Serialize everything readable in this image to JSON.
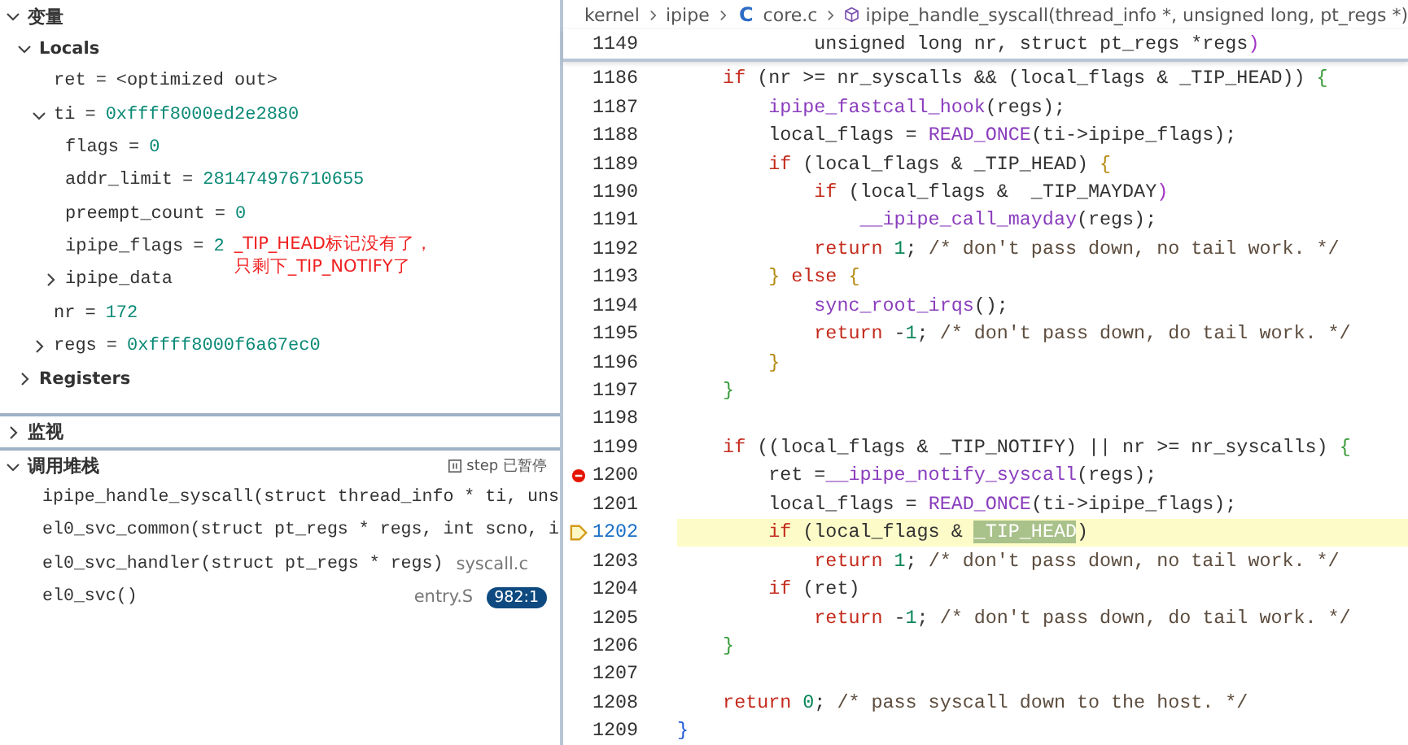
{
  "variables": {
    "title": "变量",
    "expanded": true,
    "scopes": [
      {
        "name": "Locals",
        "expanded": true,
        "children": [
          {
            "name": "ret",
            "sep": "=",
            "value": "<optimized out>",
            "kind": "text"
          },
          {
            "name": "ti",
            "sep": "=",
            "value": "0xffff8000ed2e2880",
            "kind": "value",
            "expanded": true,
            "children": [
              {
                "name": "flags",
                "sep": "=",
                "value": "0",
                "kind": "value"
              },
              {
                "name": "addr_limit",
                "sep": "=",
                "value": "281474976710655",
                "kind": "value"
              },
              {
                "name": "preempt_count",
                "sep": "=",
                "value": "0",
                "kind": "value"
              },
              {
                "name": "ipipe_flags",
                "sep": "=",
                "value": "2",
                "kind": "value",
                "note": [
                  "_TIP_HEAD标记没有了，",
                  "只剩下_TIP_NOTIFY了"
                ]
              },
              {
                "name": "ipipe_data",
                "expanded": false
              }
            ]
          },
          {
            "name": "nr",
            "sep": "=",
            "value": "172",
            "kind": "value"
          },
          {
            "name": "regs",
            "sep": "=",
            "value": "0xffff8000f6a67ec0",
            "kind": "value",
            "expanded": false
          }
        ]
      },
      {
        "name": "Registers",
        "expanded": false
      }
    ]
  },
  "watch": {
    "title": "监视",
    "expanded": false
  },
  "call_stack": {
    "title": "调用堆栈",
    "expanded": true,
    "status": "step 已暂停",
    "frames": [
      {
        "name": "ipipe_handle_syscall(struct thread_info * ti, uns"
      },
      {
        "name": "el0_svc_common(struct pt_regs * regs, int scno, i"
      },
      {
        "name": "el0_svc_handler(struct pt_regs * regs)",
        "file": "syscall.c"
      },
      {
        "name": "el0_svc()",
        "file": "entry.S",
        "badge": "982:1"
      }
    ]
  },
  "breadcrumb": [
    {
      "label": "kernel",
      "kind": "folder"
    },
    {
      "label": "ipipe",
      "kind": "folder"
    },
    {
      "label": "core.c",
      "kind": "file",
      "icon": "C"
    },
    {
      "label": "ipipe_handle_syscall(thread_info *, unsigned long, pt_regs *)",
      "kind": "function"
    }
  ],
  "sticky_line": {
    "num": "1149",
    "tokens": [
      {
        "text": "            unsigned long nr, struct pt_regs *regs",
        "kind": "plain"
      },
      {
        "text": ")",
        "kind": "paren"
      }
    ]
  },
  "lines": [
    {
      "num": "1186",
      "breakpoint": false,
      "current": false,
      "tokens": [
        {
          "text": "    if",
          "kind": "keyword"
        },
        {
          "text": " (nr >= nr_syscalls && (local_flags & _TIP_HEAD)) ",
          "kind": "plain"
        },
        {
          "text": "{",
          "kind": "brace1"
        }
      ]
    },
    {
      "num": "1187",
      "breakpoint": false,
      "current": false,
      "tokens": [
        {
          "text": "        ipipe_fastcall_hook",
          "kind": "function"
        },
        {
          "text": "(regs);",
          "kind": "plain"
        }
      ]
    },
    {
      "num": "1188",
      "breakpoint": false,
      "current": false,
      "tokens": [
        {
          "text": "        local_flags = ",
          "kind": "plain"
        },
        {
          "text": "READ_ONCE",
          "kind": "function"
        },
        {
          "text": "(ti->ipipe_flags);",
          "kind": "plain"
        }
      ]
    },
    {
      "num": "1189",
      "breakpoint": false,
      "current": false,
      "tokens": [
        {
          "text": "        if",
          "kind": "keyword"
        },
        {
          "text": " (local_flags & _TIP_HEAD) ",
          "kind": "plain"
        },
        {
          "text": "{",
          "kind": "brace2"
        }
      ]
    },
    {
      "num": "1190",
      "breakpoint": false,
      "current": false,
      "tokens": [
        {
          "text": "            if",
          "kind": "keyword"
        },
        {
          "text": " (local_flags &  _TIP_MAYDAY",
          "kind": "plain"
        },
        {
          "text": ")",
          "kind": "paren"
        }
      ]
    },
    {
      "num": "1191",
      "breakpoint": false,
      "current": false,
      "tokens": [
        {
          "text": "                __ipipe_call_mayday",
          "kind": "function"
        },
        {
          "text": "(regs);",
          "kind": "plain"
        }
      ]
    },
    {
      "num": "1192",
      "breakpoint": false,
      "current": false,
      "tokens": [
        {
          "text": "            return",
          "kind": "keyword"
        },
        {
          "text": " 1",
          "kind": "number"
        },
        {
          "text": "; ",
          "kind": "plain"
        },
        {
          "text": "/* don't pass down, no tail work. */",
          "kind": "comment"
        }
      ]
    },
    {
      "num": "1193",
      "breakpoint": false,
      "current": false,
      "tokens": [
        {
          "text": "        }",
          "kind": "brace2"
        },
        {
          "text": " else",
          "kind": "keyword"
        },
        {
          "text": " {",
          "kind": "brace2"
        }
      ]
    },
    {
      "num": "1194",
      "breakpoint": false,
      "current": false,
      "tokens": [
        {
          "text": "            sync_root_irqs",
          "kind": "function"
        },
        {
          "text": "();",
          "kind": "plain"
        }
      ]
    },
    {
      "num": "1195",
      "breakpoint": false,
      "current": false,
      "tokens": [
        {
          "text": "            return",
          "kind": "keyword"
        },
        {
          "text": " -",
          "kind": "plain"
        },
        {
          "text": "1",
          "kind": "number"
        },
        {
          "text": "; ",
          "kind": "plain"
        },
        {
          "text": "/* don't pass down, do tail work. */",
          "kind": "comment"
        }
      ]
    },
    {
      "num": "1196",
      "breakpoint": false,
      "current": false,
      "tokens": [
        {
          "text": "        }",
          "kind": "brace2"
        }
      ]
    },
    {
      "num": "1197",
      "breakpoint": false,
      "current": false,
      "tokens": [
        {
          "text": "    }",
          "kind": "brace1"
        }
      ]
    },
    {
      "num": "1198",
      "breakpoint": false,
      "current": false
    },
    {
      "num": "1199",
      "breakpoint": false,
      "current": false,
      "tokens": [
        {
          "text": "    if",
          "kind": "keyword"
        },
        {
          "text": " ((local_flags & _TIP_NOTIFY) || nr >= nr_syscalls) ",
          "kind": "plain"
        },
        {
          "text": "{",
          "kind": "brace1"
        }
      ]
    },
    {
      "num": "1200",
      "breakpoint": true,
      "current": false,
      "tokens": [
        {
          "text": "        ret =",
          "kind": "plain"
        },
        {
          "text": "__ipipe_notify_syscall",
          "kind": "function"
        },
        {
          "text": "(regs);",
          "kind": "plain"
        }
      ]
    },
    {
      "num": "1201",
      "breakpoint": false,
      "current": false,
      "tokens": [
        {
          "text": "        local_flags = ",
          "kind": "plain"
        },
        {
          "text": "READ_ONCE",
          "kind": "function"
        },
        {
          "text": "(ti->ipipe_flags);",
          "kind": "plain"
        }
      ]
    },
    {
      "num": "1202",
      "breakpoint": false,
      "current": true,
      "tokens": [
        {
          "text": "        if",
          "kind": "keyword"
        },
        {
          "text": " (local_flags & ",
          "kind": "plain"
        },
        {
          "text": "_TIP_HEAD",
          "kind": "highlight"
        },
        {
          "text": ")",
          "kind": "plain"
        }
      ]
    },
    {
      "num": "1203",
      "breakpoint": false,
      "current": false,
      "tokens": [
        {
          "text": "            return",
          "kind": "keyword"
        },
        {
          "text": " 1",
          "kind": "number"
        },
        {
          "text": "; ",
          "kind": "plain"
        },
        {
          "text": "/* don't pass down, no tail work. */",
          "kind": "comment"
        }
      ]
    },
    {
      "num": "1204",
      "breakpoint": false,
      "current": false,
      "tokens": [
        {
          "text": "        if",
          "kind": "keyword"
        },
        {
          "text": " (ret)",
          "kind": "plain"
        }
      ]
    },
    {
      "num": "1205",
      "breakpoint": false,
      "current": false,
      "tokens": [
        {
          "text": "            return",
          "kind": "keyword"
        },
        {
          "text": " -",
          "kind": "plain"
        },
        {
          "text": "1",
          "kind": "number"
        },
        {
          "text": "; ",
          "kind": "plain"
        },
        {
          "text": "/* don't pass down, do tail work. */",
          "kind": "comment"
        }
      ]
    },
    {
      "num": "1206",
      "breakpoint": false,
      "current": false,
      "tokens": [
        {
          "text": "    }",
          "kind": "brace1"
        }
      ]
    },
    {
      "num": "1207",
      "breakpoint": false,
      "current": false
    },
    {
      "num": "1208",
      "breakpoint": false,
      "current": false,
      "tokens": [
        {
          "text": "    return",
          "kind": "keyword"
        },
        {
          "text": " 0",
          "kind": "number"
        },
        {
          "text": "; ",
          "kind": "plain"
        },
        {
          "text": "/* pass syscall down to the host. */",
          "kind": "comment"
        }
      ]
    },
    {
      "num": "1209",
      "breakpoint": false,
      "current": false,
      "tokens": [
        {
          "text": "}",
          "kind": "brace3"
        }
      ]
    }
  ]
}
